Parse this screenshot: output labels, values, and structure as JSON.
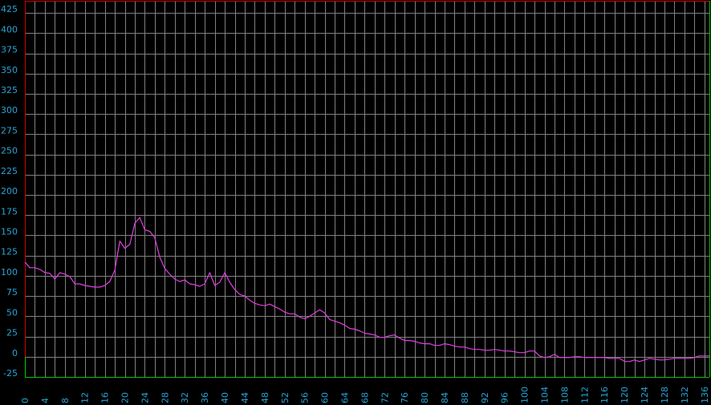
{
  "chart_data": {
    "type": "line",
    "title": "",
    "xlabel": "",
    "ylabel": "",
    "xlim": [
      0,
      137
    ],
    "ylim": [
      -25,
      440
    ],
    "x_ticks": [
      0,
      4,
      8,
      12,
      16,
      20,
      24,
      28,
      32,
      36,
      40,
      44,
      48,
      52,
      56,
      60,
      64,
      68,
      72,
      76,
      80,
      84,
      88,
      92,
      96,
      100,
      104,
      108,
      112,
      116,
      120,
      124,
      128,
      132,
      136
    ],
    "y_ticks": [
      -25,
      0,
      25,
      50,
      75,
      100,
      125,
      150,
      175,
      200,
      225,
      250,
      275,
      300,
      325,
      350,
      375,
      400,
      425
    ],
    "grid": true,
    "legend": "none",
    "colors": {
      "background": "#000000",
      "grid": "#808080",
      "axis_low": "#00c800",
      "axis_high": "#d00000",
      "line": "#e040e0",
      "tick_text": "#29a3d6"
    },
    "series": [
      {
        "values": [
          [
            0,
            117
          ],
          [
            1,
            110
          ],
          [
            2,
            110
          ],
          [
            3,
            108
          ],
          [
            4,
            104
          ],
          [
            5,
            103
          ],
          [
            6,
            96
          ],
          [
            7,
            104
          ],
          [
            8,
            102
          ],
          [
            9,
            99
          ],
          [
            10,
            90
          ],
          [
            11,
            90
          ],
          [
            12,
            88
          ],
          [
            13,
            87
          ],
          [
            14,
            86
          ],
          [
            15,
            86
          ],
          [
            16,
            88
          ],
          [
            17,
            93
          ],
          [
            18,
            107
          ],
          [
            19,
            143
          ],
          [
            20,
            134
          ],
          [
            21,
            139
          ],
          [
            22,
            165
          ],
          [
            23,
            172
          ],
          [
            24,
            157
          ],
          [
            25,
            155
          ],
          [
            26,
            147
          ],
          [
            27,
            123
          ],
          [
            28,
            109
          ],
          [
            29,
            102
          ],
          [
            30,
            96
          ],
          [
            31,
            93
          ],
          [
            32,
            95
          ],
          [
            33,
            90
          ],
          [
            34,
            89
          ],
          [
            35,
            87
          ],
          [
            36,
            90
          ],
          [
            37,
            104
          ],
          [
            38,
            88
          ],
          [
            39,
            92
          ],
          [
            40,
            104
          ],
          [
            41,
            92
          ],
          [
            42,
            83
          ],
          [
            43,
            77
          ],
          [
            44,
            75
          ],
          [
            45,
            70
          ],
          [
            46,
            66
          ],
          [
            47,
            64
          ],
          [
            48,
            63
          ],
          [
            49,
            65
          ],
          [
            50,
            62
          ],
          [
            51,
            59
          ],
          [
            52,
            55
          ],
          [
            53,
            53
          ],
          [
            54,
            53
          ],
          [
            55,
            49
          ],
          [
            56,
            47
          ],
          [
            57,
            50
          ],
          [
            58,
            54
          ],
          [
            59,
            58
          ],
          [
            60,
            54
          ],
          [
            61,
            46
          ],
          [
            62,
            44
          ],
          [
            63,
            42
          ],
          [
            64,
            39
          ],
          [
            65,
            35
          ],
          [
            66,
            34
          ],
          [
            67,
            32
          ],
          [
            68,
            29
          ],
          [
            69,
            28
          ],
          [
            70,
            27
          ],
          [
            71,
            24
          ],
          [
            72,
            24
          ],
          [
            73,
            26
          ],
          [
            74,
            27
          ],
          [
            75,
            23
          ],
          [
            76,
            20
          ],
          [
            77,
            20
          ],
          [
            78,
            19
          ],
          [
            79,
            17
          ],
          [
            80,
            16
          ],
          [
            81,
            16
          ],
          [
            82,
            14
          ],
          [
            83,
            14
          ],
          [
            84,
            16
          ],
          [
            85,
            15
          ],
          [
            86,
            13
          ],
          [
            87,
            12
          ],
          [
            88,
            12
          ],
          [
            89,
            10
          ],
          [
            90,
            9
          ],
          [
            91,
            9
          ],
          [
            92,
            8
          ],
          [
            93,
            8
          ],
          [
            94,
            9
          ],
          [
            95,
            8
          ],
          [
            96,
            7
          ],
          [
            97,
            7
          ],
          [
            98,
            6
          ],
          [
            99,
            5
          ],
          [
            100,
            5
          ],
          [
            101,
            7
          ],
          [
            102,
            7
          ],
          [
            103,
            1
          ],
          [
            104,
            -1
          ],
          [
            105,
            0
          ],
          [
            106,
            3
          ],
          [
            107,
            -1
          ],
          [
            108,
            -1
          ],
          [
            109,
            -1
          ],
          [
            110,
            0
          ],
          [
            111,
            0
          ],
          [
            112,
            -1
          ],
          [
            113,
            -1
          ],
          [
            114,
            -1
          ],
          [
            115,
            -1
          ],
          [
            116,
            -1
          ],
          [
            117,
            -2
          ],
          [
            118,
            -2
          ],
          [
            119,
            -2
          ],
          [
            120,
            -6
          ],
          [
            121,
            -6
          ],
          [
            122,
            -4
          ],
          [
            123,
            -6
          ],
          [
            124,
            -4
          ],
          [
            125,
            -2
          ],
          [
            126,
            -3
          ],
          [
            127,
            -4
          ],
          [
            128,
            -4
          ],
          [
            129,
            -3
          ],
          [
            130,
            -2
          ],
          [
            131,
            -2
          ],
          [
            132,
            -2
          ],
          [
            133,
            -2
          ],
          [
            134,
            -1
          ],
          [
            135,
            1
          ],
          [
            136,
            1
          ],
          [
            137,
            1
          ]
        ]
      }
    ]
  }
}
